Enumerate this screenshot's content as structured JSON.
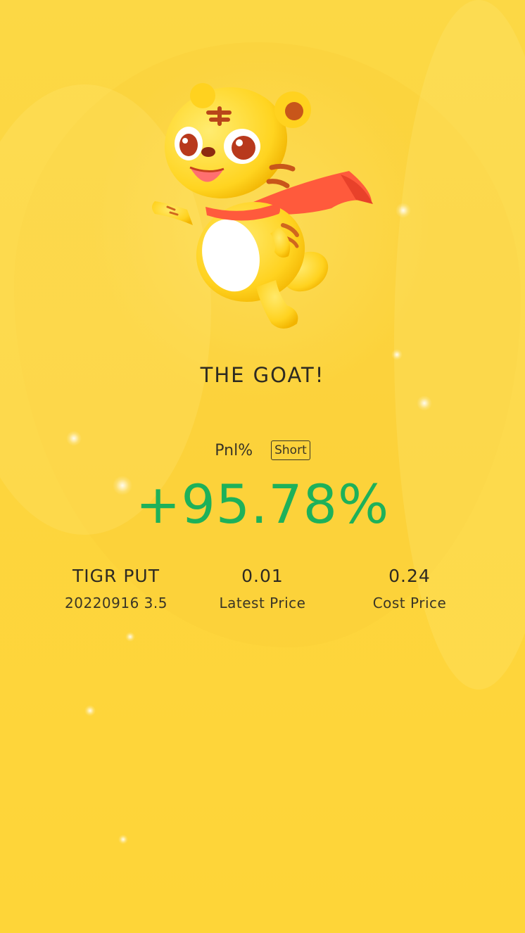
{
  "headline": "THE GOAT!",
  "pnl": {
    "label": "Pnl%",
    "direction_badge": "Short",
    "value": "+95.78%",
    "value_color": "#1DB15A"
  },
  "position": {
    "name": "TIGR PUT",
    "contract": "20220916 3.5"
  },
  "latest": {
    "value": "0.01",
    "label": "Latest Price"
  },
  "cost": {
    "value": "0.24",
    "label": "Cost Price"
  },
  "mascot": {
    "icon": "tiger-mascot-icon"
  },
  "colors": {
    "background": "#FFD43A",
    "gain": "#1DB15A"
  }
}
